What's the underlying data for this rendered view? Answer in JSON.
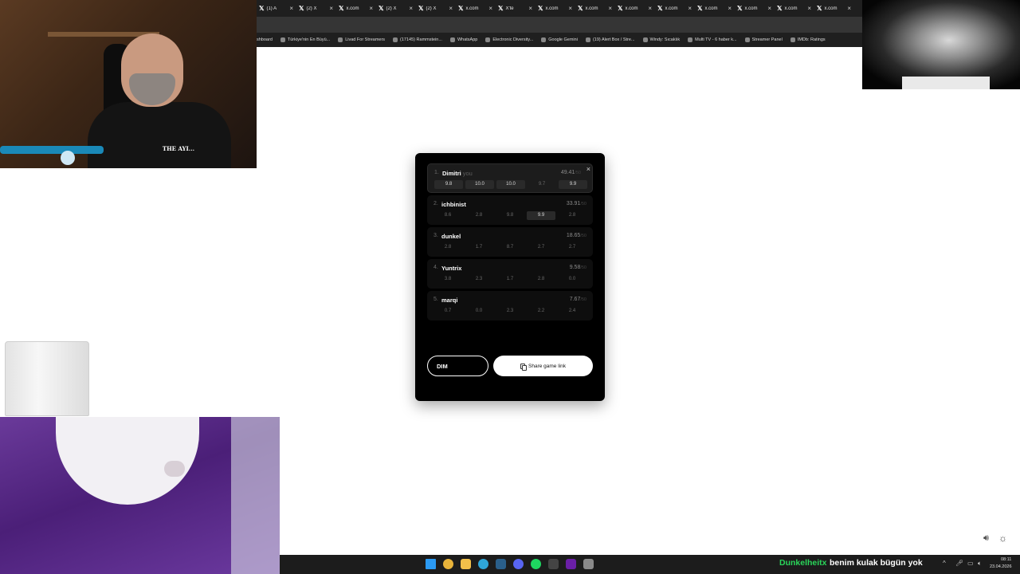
{
  "browser": {
    "tabs": [
      {
        "title": "(1) A"
      },
      {
        "title": "(2) X"
      },
      {
        "title": "x.com"
      },
      {
        "title": "(2) X"
      },
      {
        "title": "(2) X"
      },
      {
        "title": "x.com"
      },
      {
        "title": "X'te"
      },
      {
        "title": "x.com"
      },
      {
        "title": "x.com"
      },
      {
        "title": "x.com"
      },
      {
        "title": "x.com"
      },
      {
        "title": "x.com"
      },
      {
        "title": "x.com"
      },
      {
        "title": "x.com"
      },
      {
        "title": "x.com"
      }
    ],
    "bookmarks": [
      "shboard",
      "Türkiye'nin En Büyü...",
      "Livad For Streamers",
      "(17145) Rammstein...",
      "WhatsApp",
      "Electronic Diversity...",
      "Google Gemini",
      "(19) Alert Box / Stre...",
      "Windy: Sıcaklık",
      "Multi TV - 6 haber k...",
      "Streamer Panel",
      "IMDb: Ratings"
    ]
  },
  "overlays": {
    "shirt_text": "THE AYI..."
  },
  "game": {
    "close_label": "×",
    "max_suffix": "/50",
    "you_label": "you",
    "leaderboard": [
      {
        "rank": "1.",
        "name": "Dimitri",
        "total": "49.41",
        "scores": [
          "9.8",
          "10.0",
          "10.0",
          "9.7",
          "9.9"
        ],
        "highlight": [
          true,
          true,
          true,
          false,
          true
        ],
        "is_you": true
      },
      {
        "rank": "2.",
        "name": "ichbinist",
        "total": "33.91",
        "scores": [
          "8.6",
          "2.8",
          "9.8",
          "9.9",
          "2.8"
        ],
        "highlight": [
          false,
          false,
          false,
          true,
          false
        ],
        "is_you": false
      },
      {
        "rank": "3.",
        "name": "dunkel",
        "total": "18.65",
        "scores": [
          "2.8",
          "1.7",
          "8.7",
          "2.7",
          "2.7"
        ],
        "highlight": [
          false,
          false,
          false,
          false,
          false
        ],
        "is_you": false
      },
      {
        "rank": "4.",
        "name": "Yuntrix",
        "total": "9.58",
        "scores": [
          "3.8",
          "2.3",
          "1.7",
          "2.8",
          "0.0"
        ],
        "highlight": [
          false,
          false,
          false,
          false,
          false
        ],
        "is_you": false
      },
      {
        "rank": "5.",
        "name": "marqi",
        "total": "7.67",
        "scores": [
          "0.7",
          "0.0",
          "2.3",
          "2.2",
          "2.4"
        ],
        "highlight": [
          false,
          false,
          false,
          false,
          false
        ],
        "is_you": false
      }
    ],
    "name_input_value": "DIM",
    "share_label": "Share game link"
  },
  "page_controls": {
    "volume_icon": "speaker-icon",
    "theme_icon": "sun-icon"
  },
  "taskbar": {
    "apps": [
      {
        "name": "windows-start",
        "color": "#2b9af3"
      },
      {
        "name": "chrome",
        "color": "#e8b33a"
      },
      {
        "name": "file-explorer",
        "color": "#f2c04a"
      },
      {
        "name": "edge",
        "color": "#2fa6d8"
      },
      {
        "name": "steam",
        "color": "#2a5f8a"
      },
      {
        "name": "discord",
        "color": "#5865f2"
      },
      {
        "name": "spotify",
        "color": "#1ed760"
      },
      {
        "name": "epic-games",
        "color": "#444444"
      },
      {
        "name": "kick",
        "color": "#6a1fa6"
      },
      {
        "name": "settings",
        "color": "#8a8a8a"
      }
    ],
    "chat_user": "Dunkelheitx",
    "chat_message": "benim kulak bügün yok",
    "clock_time": "08:11",
    "clock_date": "23.04.2026"
  }
}
